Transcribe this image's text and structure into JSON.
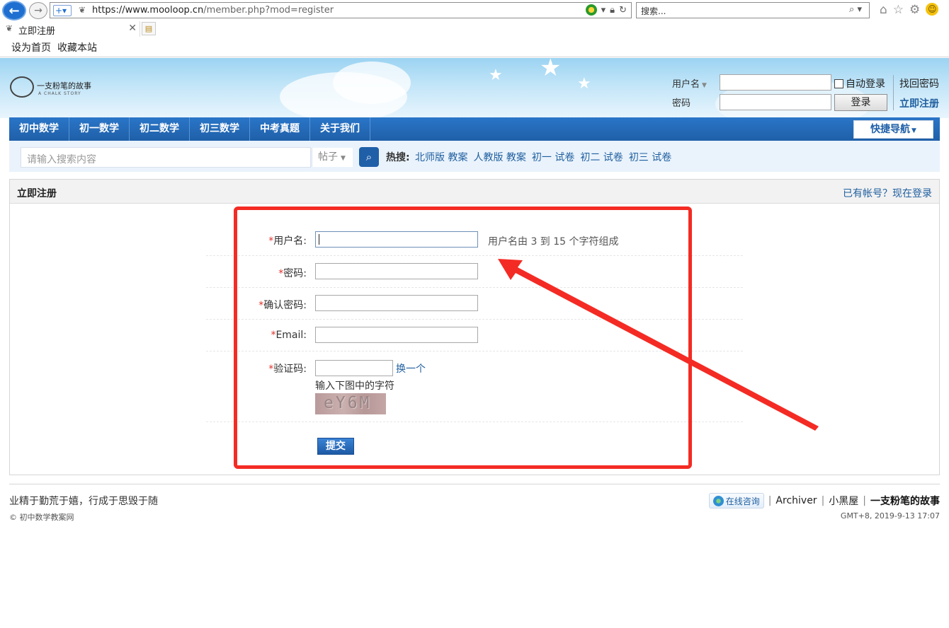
{
  "browser": {
    "url_main": "https://www.mooloop.cn",
    "url_rest": "/member.php?mod=register",
    "search_placeholder": "搜索...",
    "tab_title": "立即注册",
    "favorites": [
      "设为首页",
      "收藏本站"
    ]
  },
  "header": {
    "logo_text": "一支粉笔的故事",
    "logo_sub": "A CHALK STORY",
    "username_label": "用户名",
    "password_label": "密码",
    "auto_login": "自动登录",
    "login_button": "登录",
    "forgot_password": "找回密码",
    "register_link": "立即注册"
  },
  "nav": {
    "items": [
      "初中数学",
      "初一数学",
      "初二数学",
      "初三数学",
      "中考真题",
      "关于我们"
    ],
    "quick_nav": "快捷导航"
  },
  "search": {
    "placeholder": "请输入搜索内容",
    "type": "帖子",
    "hot_label": "热搜:",
    "hot_links": [
      "北师版 教案",
      "人教版 教案",
      "初一 试卷",
      "初二 试卷",
      "初三 试卷"
    ]
  },
  "register": {
    "title": "立即注册",
    "login_link": "已有帐号？现在登录",
    "required_mark": "*",
    "username_label": "用户名:",
    "username_tip": "用户名由 3 到 15 个字符组成",
    "password_label": "密码:",
    "confirm_label": "确认密码:",
    "email_label": "Email:",
    "captcha_label": "验证码:",
    "captcha_change": "换一个",
    "captcha_hint": "输入下图中的字符",
    "captcha_text": "eY6M",
    "submit": "提交"
  },
  "footer": {
    "motto": "业精于勤荒于嬉，行成于思毁于随",
    "copyright": "© 初中数学教案网",
    "consult": "在线咨询",
    "archiver": "Archiver",
    "blackhouse": "小黑屋",
    "story": "一支粉笔的故事",
    "time": "GMT+8, 2019-9-13 17:07"
  },
  "colors": {
    "annotation": "#f42b24",
    "nav_blue": "#1f5fa8",
    "link_blue": "#1f5f9f"
  }
}
